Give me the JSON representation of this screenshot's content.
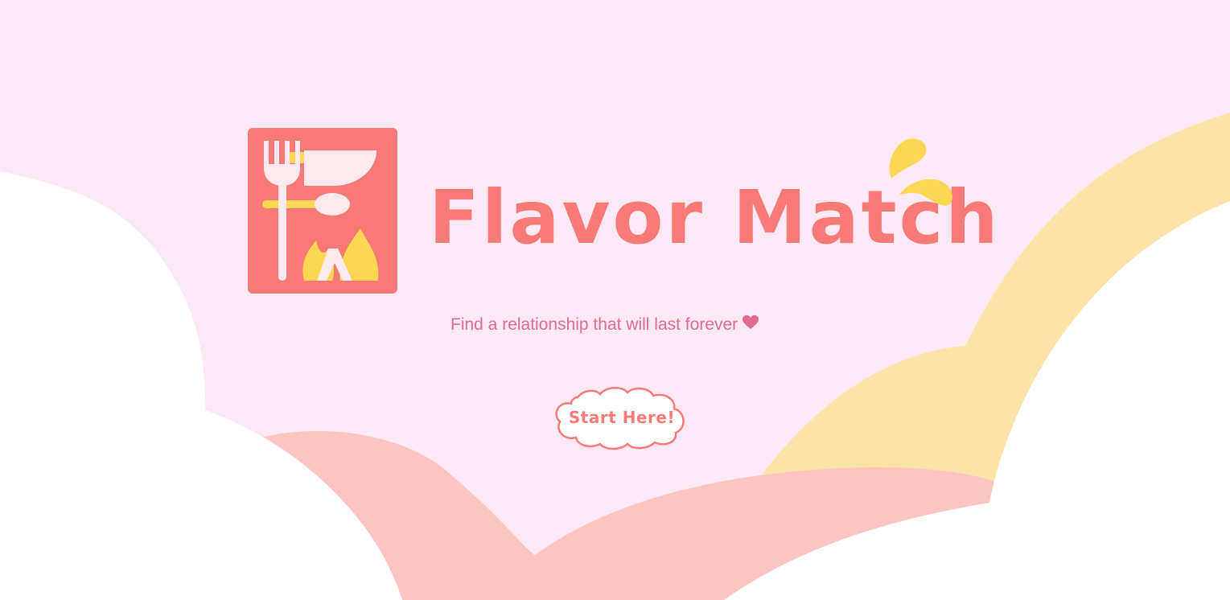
{
  "app": {
    "title": "Flavor Match",
    "tagline": "Find a relationship that will last forever",
    "tagline_icon": "heart-icon",
    "logo_icon": "kitchen-utensils-flame-logo-icon"
  },
  "cta": {
    "label": "Start Here!"
  },
  "colors": {
    "background": "#fde9f5",
    "brand_coral": "#f77a76",
    "tagline_pink": "#e06b8f",
    "accent_yellow": "#fdd653",
    "wave_yellow": "#fde3a7",
    "wave_pink": "#fdc5c1",
    "cloud_white": "#ffffff"
  }
}
